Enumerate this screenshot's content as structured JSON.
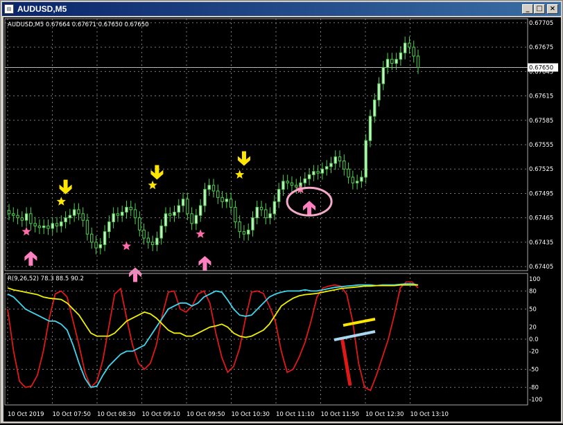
{
  "window": {
    "title": "AUDUSD,M5",
    "controls": [
      "_",
      "□",
      "×"
    ]
  },
  "price_panel": {
    "header": "AUDUSD,M5  0.67664 0.67671 0.67650 0.67650",
    "current_price_label": "0.67650",
    "bid_line_label": "0.67650",
    "y_ticks": [
      "0.67705",
      "0.67675",
      "0.67645",
      "0.67615",
      "0.67585",
      "0.67555",
      "0.67525",
      "0.67495",
      "0.67465",
      "0.67435",
      "0.67405"
    ]
  },
  "indicator_panel": {
    "header": "R(9,26,52) 78.3 88.5 90.2",
    "y_ticks": [
      "100",
      "80",
      "50",
      "20",
      "0.0",
      "-20",
      "-50",
      "-80",
      "-100"
    ]
  },
  "x_ticks": [
    "10 Oct 2019",
    "10 Oct 07:50",
    "10 Oct 08:30",
    "10 Oct 09:10",
    "10 Oct 09:50",
    "10 Oct 10:30",
    "10 Oct 11:10",
    "10 Oct 11:50",
    "10 Oct 12:30",
    "10 Oct 13:10"
  ],
  "colors": {
    "background": "#000000",
    "grid": "#7a7a7a",
    "candle_up": "#c8f0c8",
    "candle_down": "#000000",
    "candle_wick": "#4fd24f",
    "arrow_down": "#ffe600",
    "arrow_up": "#ff80c0",
    "star_yellow": "#ffe600",
    "star_pink": "#ff6aa8",
    "line_fast": "#e01818",
    "line_mid": "#40d8f0",
    "line_slow": "#f0f000"
  },
  "chart_data": [
    {
      "type": "candlestick",
      "title": "AUDUSD,M5",
      "ohlc_header": [
        0.67664,
        0.67671,
        0.6765,
        0.6765
      ],
      "ylim": [
        0.674,
        0.6771
      ],
      "closes": [
        0.6747,
        0.67468,
        0.67465,
        0.67462,
        0.6747,
        0.67458,
        0.67455,
        0.67453,
        0.67455,
        0.67452,
        0.67458,
        0.67455,
        0.6746,
        0.67465,
        0.67468,
        0.67475,
        0.6747,
        0.67462,
        0.67445,
        0.67435,
        0.67428,
        0.67432,
        0.67448,
        0.6746,
        0.6747,
        0.67468,
        0.67472,
        0.67478,
        0.67475,
        0.67465,
        0.6745,
        0.6744,
        0.67435,
        0.67432,
        0.6744,
        0.67455,
        0.6747,
        0.67468,
        0.67472,
        0.6748,
        0.67488,
        0.6747,
        0.67458,
        0.67468,
        0.6748,
        0.675,
        0.67505,
        0.67498,
        0.6749,
        0.67485,
        0.67488,
        0.67478,
        0.6746,
        0.67448,
        0.67445,
        0.6745,
        0.67465,
        0.67478,
        0.67475,
        0.67465,
        0.6747,
        0.67485,
        0.675,
        0.6751,
        0.67508,
        0.67505,
        0.67503,
        0.67508,
        0.67513,
        0.67518,
        0.67522,
        0.6752,
        0.67525,
        0.67528,
        0.67532,
        0.6754,
        0.67535,
        0.67525,
        0.67515,
        0.67508,
        0.6751,
        0.67515,
        0.6756,
        0.6759,
        0.6761,
        0.6763,
        0.6765,
        0.6766,
        0.67655,
        0.6766,
        0.67668,
        0.6768,
        0.67675,
        0.67664,
        0.6765
      ],
      "markers": [
        {
          "type": "star-yellow",
          "index": 12,
          "price": 0.67485
        },
        {
          "type": "arrow-down",
          "index": 13,
          "price": 0.675
        },
        {
          "type": "star-pink",
          "index": 4,
          "price": 0.67448
        },
        {
          "type": "arrow-up",
          "index": 5,
          "price": 0.67418
        },
        {
          "type": "star-yellow",
          "index": 33,
          "price": 0.67505
        },
        {
          "type": "arrow-down",
          "index": 34,
          "price": 0.67518
        },
        {
          "type": "star-pink",
          "index": 27,
          "price": 0.6743
        },
        {
          "type": "arrow-up",
          "index": 29,
          "price": 0.67398
        },
        {
          "type": "star-pink",
          "index": 44,
          "price": 0.67445
        },
        {
          "type": "arrow-up",
          "index": 45,
          "price": 0.67412
        },
        {
          "type": "star-yellow",
          "index": 53,
          "price": 0.67518
        },
        {
          "type": "arrow-down",
          "index": 54,
          "price": 0.67535
        },
        {
          "type": "star-pink",
          "index": 67,
          "price": 0.675
        },
        {
          "type": "arrow-up",
          "index": 69,
          "price": 0.6748
        }
      ],
      "annotation": {
        "type": "ellipse",
        "index": 69,
        "price": 0.67485,
        "color": "#f5a8c8"
      }
    },
    {
      "type": "line",
      "title": "R(9,26,52) 78.3 88.5 90.2",
      "ylim": [
        -100,
        100
      ],
      "series": [
        {
          "color": "#e01818",
          "values": [
            50,
            -20,
            -70,
            -80,
            -78,
            -60,
            -20,
            35,
            75,
            80,
            70,
            30,
            -10,
            -55,
            -80,
            -70,
            -35,
            20,
            75,
            84,
            35,
            -10,
            -40,
            -50,
            -40,
            -10,
            40,
            78,
            80,
            50,
            45,
            55,
            75,
            80,
            60,
            10,
            -30,
            -55,
            -45,
            -15,
            35,
            78,
            80,
            76,
            55,
            30,
            -20,
            -55,
            -50,
            -30,
            -5,
            30,
            70,
            85,
            88,
            90,
            88,
            75,
            30,
            -40,
            -80,
            -85,
            -60,
            -30,
            0,
            40,
            85,
            95,
            95,
            85
          ]
        },
        {
          "color": "#40d8f0",
          "values": [
            75,
            70,
            60,
            50,
            45,
            40,
            35,
            30,
            30,
            25,
            15,
            -10,
            -40,
            -65,
            -80,
            -78,
            -60,
            -45,
            -35,
            -25,
            -20,
            -20,
            -15,
            -10,
            5,
            20,
            35,
            50,
            55,
            60,
            60,
            55,
            60,
            70,
            75,
            80,
            78,
            65,
            50,
            40,
            38,
            40,
            50,
            60,
            70,
            75,
            78,
            80,
            80,
            80,
            82,
            80,
            80,
            82,
            84,
            86,
            87,
            88,
            89,
            90,
            90,
            90,
            89,
            90,
            90,
            90,
            91,
            92,
            92,
            90
          ]
        },
        {
          "color": "#f0f000",
          "values": [
            85,
            82,
            80,
            78,
            76,
            74,
            70,
            68,
            67,
            66,
            60,
            50,
            40,
            25,
            10,
            5,
            5,
            5,
            10,
            20,
            30,
            35,
            40,
            45,
            42,
            35,
            25,
            15,
            10,
            10,
            5,
            5,
            10,
            15,
            20,
            22,
            25,
            20,
            10,
            5,
            3,
            5,
            10,
            15,
            25,
            40,
            55,
            62,
            68,
            72,
            74,
            75,
            76,
            78,
            80,
            82,
            84,
            85,
            86,
            87,
            88,
            88,
            89,
            89,
            89,
            89,
            90,
            90,
            90,
            90
          ]
        }
      ]
    }
  ]
}
